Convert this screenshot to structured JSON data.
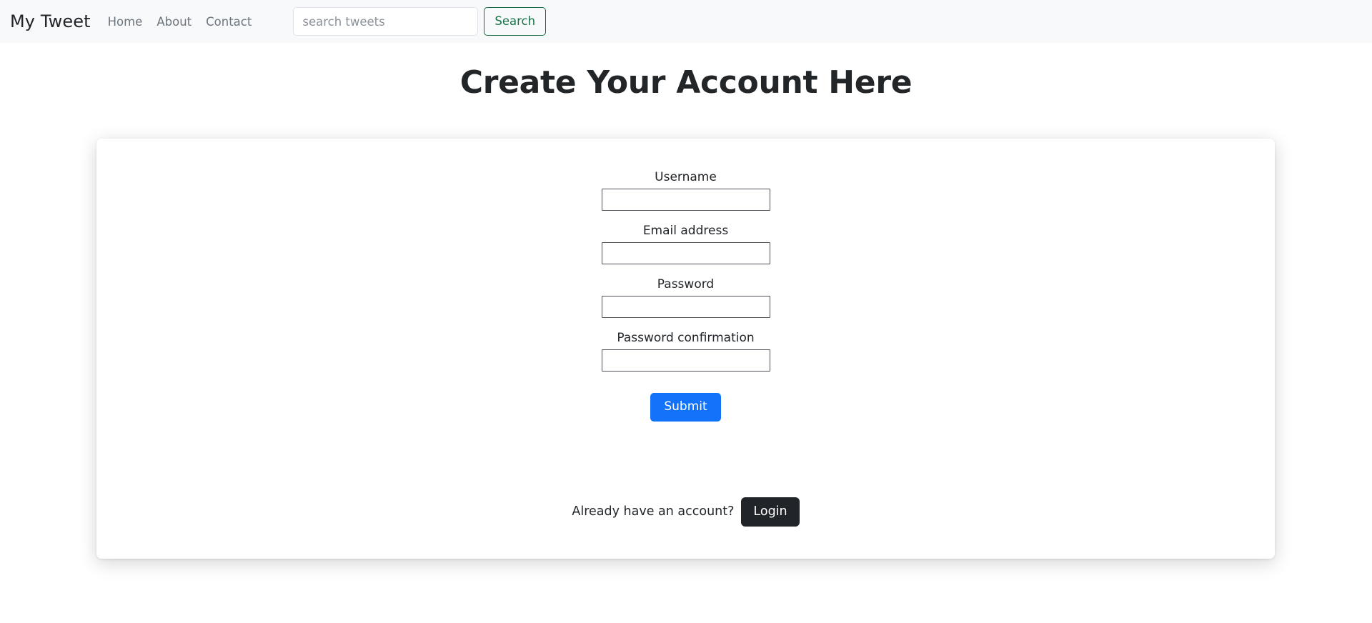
{
  "navbar": {
    "brand": "My Tweet",
    "links": [
      {
        "label": "Home"
      },
      {
        "label": "About"
      },
      {
        "label": "Contact"
      }
    ],
    "search": {
      "placeholder": "search tweets",
      "value": "",
      "button_label": "Search",
      "button_border_color": "#176c43",
      "button_text_color": "#157347"
    },
    "background_color": "#f8f9fa"
  },
  "main": {
    "page_title": "Create Your Account Here",
    "form": {
      "fields": [
        {
          "label": "Username",
          "value": "",
          "type": "text"
        },
        {
          "label": "Email address",
          "value": "",
          "type": "email"
        },
        {
          "label": "Password",
          "value": "",
          "type": "password"
        },
        {
          "label": "Password confirmation",
          "value": "",
          "type": "password"
        }
      ],
      "submit_label": "Submit",
      "submit_color": "#1273fa"
    },
    "footer": {
      "prompt_text": "Already have an account?",
      "login_label": "Login",
      "login_color": "#212529"
    }
  }
}
